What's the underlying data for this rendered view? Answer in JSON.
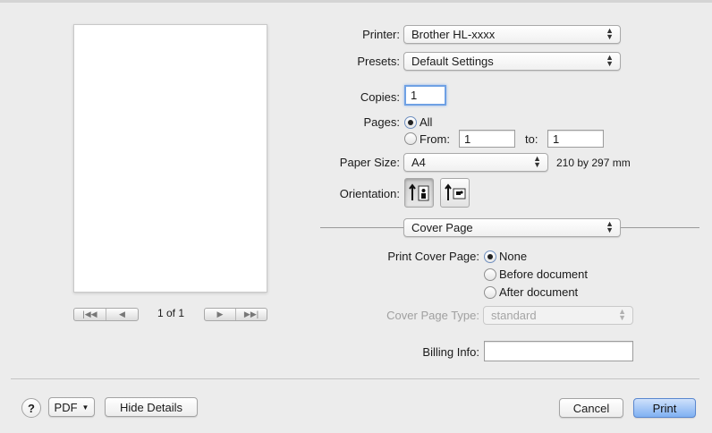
{
  "preview": {
    "page_indicator": "1 of 1",
    "nav_first_icon": "first-page-icon",
    "nav_prev_icon": "previous-page-icon",
    "nav_next_icon": "next-page-icon",
    "nav_last_icon": "last-page-icon"
  },
  "printer": {
    "label": "Printer:",
    "value": "Brother HL-xxxx"
  },
  "presets": {
    "label": "Presets:",
    "value": "Default Settings"
  },
  "copies": {
    "label": "Copies:",
    "value": "1"
  },
  "pages": {
    "label": "Pages:",
    "all_label": "All",
    "from_label": "From:",
    "from_value": "1",
    "to_label": "to:",
    "to_value": "1",
    "selected": "All"
  },
  "paper_size": {
    "label": "Paper Size:",
    "value": "A4",
    "dimensions": "210 by 297 mm"
  },
  "orientation": {
    "label": "Orientation:",
    "selected": "portrait",
    "portrait_icon": "portrait-orientation-icon",
    "landscape_icon": "landscape-orientation-icon"
  },
  "section": {
    "value": "Cover Page"
  },
  "cover_page": {
    "label": "Print Cover Page:",
    "options": [
      "None",
      "Before document",
      "After document"
    ],
    "selected": "None",
    "type_label": "Cover Page Type:",
    "type_value": "standard",
    "billing_label": "Billing Info:",
    "billing_value": ""
  },
  "footer": {
    "help_label": "?",
    "pdf_label": "PDF",
    "hide_details_label": "Hide Details",
    "cancel_label": "Cancel",
    "print_label": "Print"
  }
}
